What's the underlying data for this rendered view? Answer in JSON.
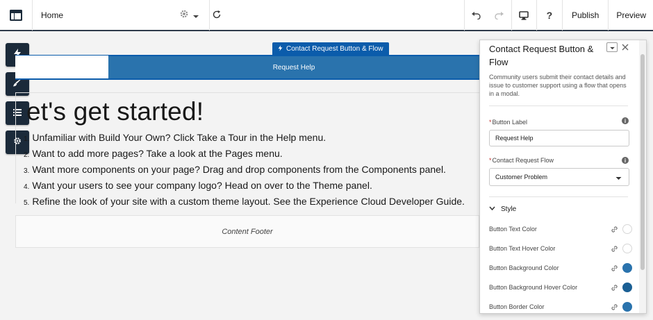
{
  "topbar": {
    "home_label": "Home",
    "publish_label": "Publish",
    "preview_label": "Preview",
    "help_label": "?"
  },
  "canvas": {
    "component_tag": "Contact Request Button & Flow",
    "button_text": "Request Help",
    "heading": "et's get started!",
    "steps": [
      {
        "num": "1.",
        "text": "Unfamiliar with Build Your Own? Click Take a Tour in the Help menu."
      },
      {
        "num": "2.",
        "text": "Want to add more pages? Take a look at the Pages menu."
      },
      {
        "num": "3.",
        "text": "Want more components on your page? Drag and drop components from the Components panel."
      },
      {
        "num": "4.",
        "text": "Want your users to see your company logo? Head on over to the Theme panel."
      },
      {
        "num": "5.",
        "text": "Refine the look of your site with a custom theme layout. See the Experience Cloud Developer Guide."
      }
    ],
    "footer": "Content Footer"
  },
  "panel": {
    "title": "Contact Request Button & Flow",
    "description": "Community users submit their contact details and issue to customer support using a flow that opens in a modal.",
    "button_label_field": {
      "label": "Button Label",
      "required": "*",
      "value": "Request Help"
    },
    "flow_field": {
      "label": "Contact Request Flow",
      "required": "*",
      "value": "Customer Problem"
    },
    "style_section": "Style",
    "style_rows": [
      {
        "label": "Button Text Color",
        "color": "#ffffff"
      },
      {
        "label": "Button Text Hover Color",
        "color": "#ffffff"
      },
      {
        "label": "Button Background Color",
        "color": "#2a73ad"
      },
      {
        "label": "Button Background Hover Color",
        "color": "#1b5f94"
      },
      {
        "label": "Button Border Color",
        "color": "#2a73ad"
      }
    ]
  },
  "icons": [
    "layout-icon",
    "gear-icon",
    "chevron-down-icon",
    "refresh-icon",
    "undo-icon",
    "redo-icon",
    "desktop-icon",
    "lightning-icon",
    "brush-icon",
    "list-icon",
    "settings-icon",
    "close-icon",
    "info-icon",
    "link-icon"
  ]
}
